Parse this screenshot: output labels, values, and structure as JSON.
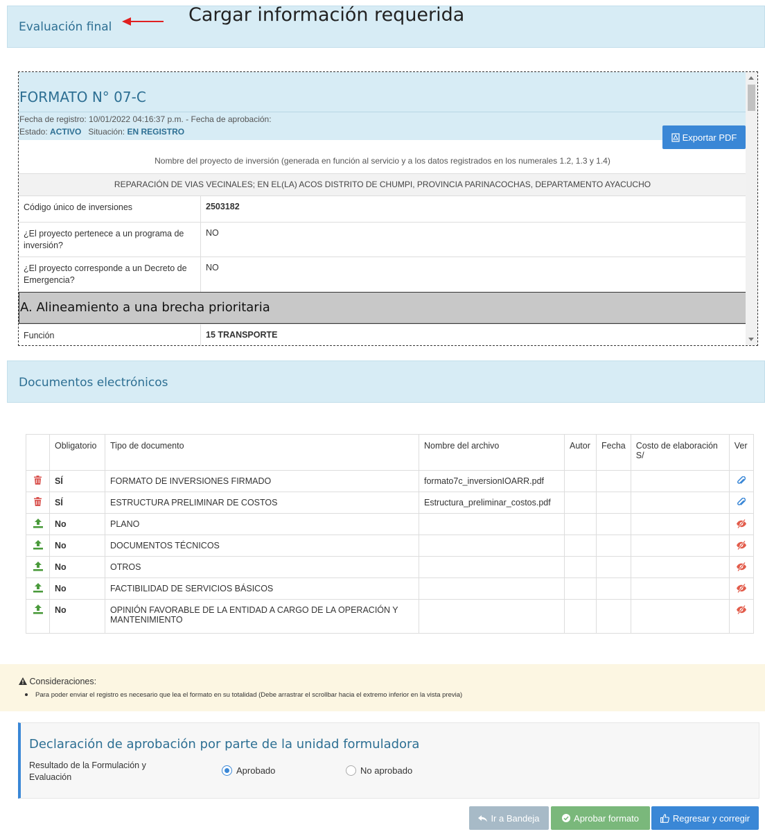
{
  "evaluacion": {
    "title": "Evaluación final"
  },
  "annotation": {
    "text": "Cargar información requerida",
    "arrow_color": "#e02020"
  },
  "formato": {
    "title": "FORMATO N° 07-C",
    "dates": "Fecha de registro: 10/01/2022 04:16:37 p.m. - Fecha de aprobación:",
    "estado_label": "Estado:",
    "estado_value": "ACTIVO",
    "situacion_label": "Situación:",
    "situacion_value": "EN REGISTRO",
    "export_label": "Exportar PDF",
    "project_caption": "Nombre del proyecto de inversión (generada en función al servicio y a los datos registrados en los numerales 1.2, 1.3 y 1.4)",
    "project_name": "REPARACIÓN DE VIAS VECINALES; EN EL(LA) ACOS DISTRITO DE CHUMPI, PROVINCIA PARINACOCHAS, DEPARTAMENTO AYACUCHO",
    "rows": [
      {
        "label": "Código único de inversiones",
        "value": "2503182"
      },
      {
        "label": "¿El proyecto pertenece a un programa de inversión?",
        "value": "NO"
      },
      {
        "label": "¿El proyecto corresponde a un Decreto de Emergencia?",
        "value": "NO"
      }
    ],
    "section_a": "A. Alineamiento a una brecha prioritaria",
    "funcion_label": "Función",
    "funcion_value": "15 TRANSPORTE"
  },
  "documentos": {
    "title": "Documentos electrónicos",
    "headers": [
      "Obligatorio",
      "Tipo de documento",
      "Nombre del archivo",
      "Autor",
      "Fecha",
      "Costo de elaboración S/",
      "Ver"
    ],
    "rows": [
      {
        "action": "delete",
        "obligatorio": "SÍ",
        "tipo": "FORMATO DE INVERSIONES FIRMADO",
        "archivo": "formato7c_inversionIOARR.pdf",
        "ver": "attach"
      },
      {
        "action": "delete",
        "obligatorio": "SÍ",
        "tipo": "ESTRUCTURA PRELIMINAR DE COSTOS",
        "archivo": "Estructura_preliminar_costos.pdf",
        "ver": "attach"
      },
      {
        "action": "upload",
        "obligatorio": "No",
        "tipo": "PLANO",
        "archivo": "",
        "ver": "hidden"
      },
      {
        "action": "upload",
        "obligatorio": "No",
        "tipo": "DOCUMENTOS TÉCNICOS",
        "archivo": "",
        "ver": "hidden"
      },
      {
        "action": "upload",
        "obligatorio": "No",
        "tipo": "OTROS",
        "archivo": "",
        "ver": "hidden"
      },
      {
        "action": "upload",
        "obligatorio": "No",
        "tipo": "FACTIBILIDAD DE SERVICIOS BÁSICOS",
        "archivo": "",
        "ver": "hidden"
      },
      {
        "action": "upload",
        "obligatorio": "No",
        "tipo": "OPINIÓN FAVORABLE DE LA ENTIDAD A CARGO DE LA OPERACIÓN Y MANTENIMIENTO",
        "archivo": "",
        "ver": "hidden"
      }
    ]
  },
  "consideraciones": {
    "title": "Consideraciones:",
    "item": "Para poder enviar el registro es necesario que lea el formato en su totalidad (Debe arrastrar el scrollbar hacia el extremo inferior en la vista previa)"
  },
  "declaracion": {
    "title": "Declaración de aprobación por parte de la unidad formuladora",
    "label": "Resultado de la Formulación y Evaluación",
    "options": [
      {
        "label": "Aprobado",
        "selected": true
      },
      {
        "label": "No aprobado",
        "selected": false
      }
    ]
  },
  "buttons": {
    "bandeja": "Ir a Bandeja",
    "aprobar": "Aprobar formato",
    "regresar": "Regresar y corregir"
  },
  "colors": {
    "primary": "#3a87d6",
    "success": "#7ab87b",
    "muted": "#a7bac7",
    "delete": "#d9534f",
    "upload": "#4a9a3b",
    "hidden": "#e25b4a"
  }
}
